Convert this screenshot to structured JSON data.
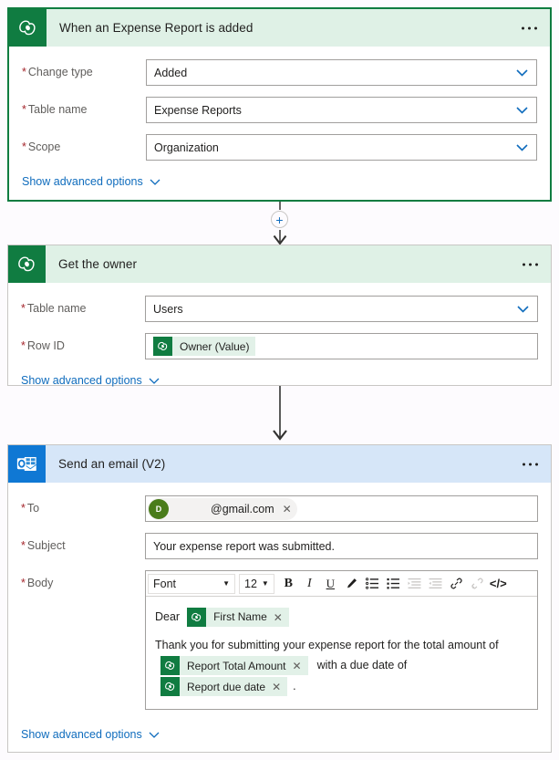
{
  "flow": {
    "cards": [
      {
        "id": "trigger",
        "icon": "dataverse-icon",
        "title": "When an Expense Report is added",
        "more_label": "…",
        "fields": [
          {
            "label": "Change type",
            "required": true,
            "type": "select",
            "value": "Added"
          },
          {
            "label": "Table name",
            "required": true,
            "type": "select",
            "value": "Expense Reports"
          },
          {
            "label": "Scope",
            "required": true,
            "type": "select",
            "value": "Organization"
          }
        ],
        "advanced_label": "Show advanced options"
      },
      {
        "id": "get-owner",
        "icon": "dataverse-icon",
        "title": "Get the owner",
        "more_label": "…",
        "fields": [
          {
            "label": "Table name",
            "required": true,
            "type": "select",
            "value": "Users"
          },
          {
            "label": "Row ID",
            "required": true,
            "type": "token",
            "token": "Owner (Value)"
          }
        ],
        "advanced_label": "Show advanced options"
      },
      {
        "id": "send-email",
        "icon": "outlook-icon",
        "title": "Send an email (V2)",
        "more_label": "…",
        "advanced_label": "Show advanced options"
      }
    ],
    "connector_plus_label": "+"
  },
  "email": {
    "to": {
      "label": "To",
      "required": true,
      "avatar_initial": "D",
      "recipient": "@gmail.com",
      "remove_label": "✕"
    },
    "subject": {
      "label": "Subject",
      "required": true,
      "value": "Your expense report was submitted."
    },
    "body": {
      "label": "Body",
      "required": true,
      "toolbar": {
        "font_label": "Font",
        "size_label": "12",
        "bold": "B",
        "italic": "I",
        "underline": "U",
        "highlight": "highlighter",
        "numbered_list": "numbered-list",
        "bullet_list": "bullet-list",
        "indent": "indent",
        "outdent": "outdent",
        "link": "link",
        "unlink": "unlink",
        "code": "</>"
      },
      "content": {
        "greeting_text": "Dear",
        "greeting_token": "First Name",
        "paragraph_text": "Thank you for submitting your expense report for the total amount of",
        "amount_token": "Report Total Amount",
        "mid_text": "with a due date of",
        "date_token": "Report due date",
        "trailing_text": ".",
        "token_remove": "✕"
      }
    }
  },
  "colors": {
    "dataverse_green": "#107c41",
    "header_green": "#dff1e6",
    "outlook_blue": "#0f78d4",
    "header_blue": "#d6e6f8",
    "link_blue": "#0f6cbd",
    "required_red": "#a4262c",
    "token_bg": "#e2f1e8",
    "avatar_green": "#4a7c1b",
    "page_bg": "#fdfbfe"
  }
}
